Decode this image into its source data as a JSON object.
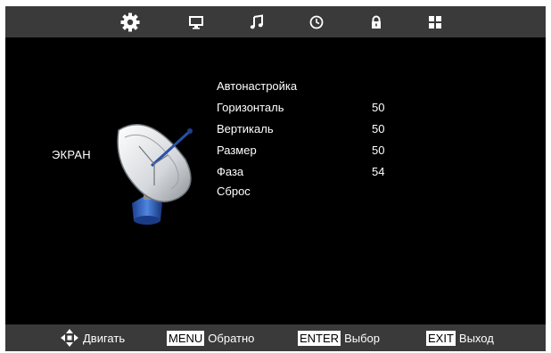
{
  "tabs": [
    {
      "icon": "gear-icon",
      "active": true
    },
    {
      "icon": "monitor-icon",
      "active": false
    },
    {
      "icon": "music-note-icon",
      "active": false
    },
    {
      "icon": "clock-icon",
      "active": false
    },
    {
      "icon": "lock-icon",
      "active": false
    },
    {
      "icon": "grid-icon",
      "active": false
    }
  ],
  "section": {
    "title": "ЭКРАН",
    "icon": "satellite-dish-icon"
  },
  "menu": {
    "items": [
      {
        "label": "Автонастройка",
        "value": ""
      },
      {
        "label": "Горизонталь",
        "value": "50"
      },
      {
        "label": "Вертикаль",
        "value": "50"
      },
      {
        "label": "Размер",
        "value": "50"
      },
      {
        "label": "Фаза",
        "value": "54"
      },
      {
        "label": "Сброс",
        "value": ""
      }
    ]
  },
  "footer": {
    "move_label": "Двигать",
    "menu_key": "MENU",
    "menu_label": "Обратно",
    "enter_key": "ENTER",
    "enter_label": "Выбор",
    "exit_key": "EXIT",
    "exit_label": "Выход"
  },
  "colors": {
    "background": "#000000",
    "bar": "#3a3a3a",
    "text": "#ffffff"
  }
}
